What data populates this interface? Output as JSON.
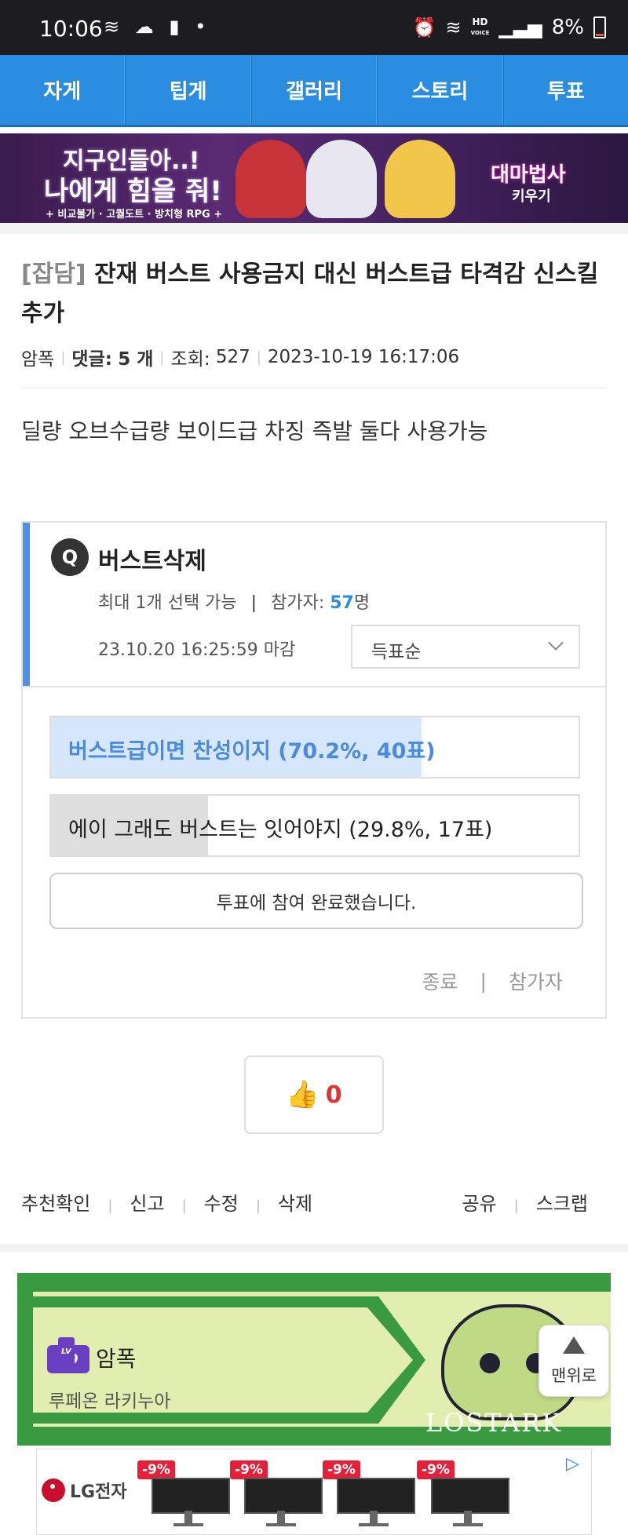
{
  "status_bar": {
    "time": "10:06",
    "battery": "8%",
    "left_icons": [
      "wifi-icon",
      "cloud-icon",
      "alert-icon",
      "dot-icon"
    ],
    "right_icons": [
      "alarm-icon",
      "wifi-icon",
      "hd-voice-icon",
      "signal-icon",
      "battery-icon"
    ],
    "hd_label_1": "HD",
    "hd_label_2": "VOICE"
  },
  "nav": {
    "tabs": [
      {
        "label": "자게"
      },
      {
        "label": "팁게"
      },
      {
        "label": "갤러리"
      },
      {
        "label": "스토리"
      },
      {
        "label": "투표"
      }
    ],
    "color": "#2a8de0"
  },
  "banner": {
    "line1": "지구인들아..!",
    "line2": "나에게 힘을 줘!",
    "line3": "+ 비교불가 · 고퀄도트 · 방치형 RPG +",
    "logo1": "대마법사",
    "logo2": "키우기"
  },
  "post": {
    "category": "[잡담]",
    "title": "잔재 버스트 사용금지 대신 버스트급 타격감 신스킬 추가",
    "author": "암폭",
    "comments_label": "댓글:",
    "comments_count": "5 개",
    "views_label": "조회:",
    "views": "527",
    "datetime": "2023-10-19 16:17:06",
    "body": "딜량 오브수급량 보이드급 차징 즉발 둘다 사용가능"
  },
  "poll": {
    "q_badge": "Q",
    "question": "버스트삭제",
    "max_select": "최대 1개 선택 가능",
    "separator": "|",
    "participants_label": "참가자:",
    "participants_count": "57",
    "participants_unit": "명",
    "deadline": "23.10.20 16:25:59 마감",
    "sort_label": "득표순",
    "options": [
      {
        "text": "버스트급이면 찬성이지 (70.2%, 40표)",
        "percent": 70.2,
        "votes": 40
      },
      {
        "text": "에이 그래도 버스트는 잇어야지 (29.8%, 17표)",
        "percent": 29.8,
        "votes": 17
      }
    ],
    "done_label": "투표에 참여 완료했습니다.",
    "footer_end": "종료",
    "footer_sep": "|",
    "footer_participants": "참가자",
    "accent_color": "#4e90e8"
  },
  "like": {
    "count": "0",
    "icon": "thumbs-up-icon"
  },
  "actions": {
    "recommend_check": "추천확인",
    "report": "신고",
    "edit": "수정",
    "delete": "삭제",
    "share": "공유",
    "scrap": "스크랩",
    "sep": "|"
  },
  "user_card": {
    "level_tag": "LV",
    "level": "70",
    "name": "암폭",
    "class": "루페온 라키누아",
    "game_logo": "LOSTARK"
  },
  "to_top": {
    "label": "맨위로"
  },
  "ad": {
    "brand": "LG전자",
    "discounts": [
      "-9%",
      "-9%",
      "-9%",
      "-9%"
    ]
  }
}
